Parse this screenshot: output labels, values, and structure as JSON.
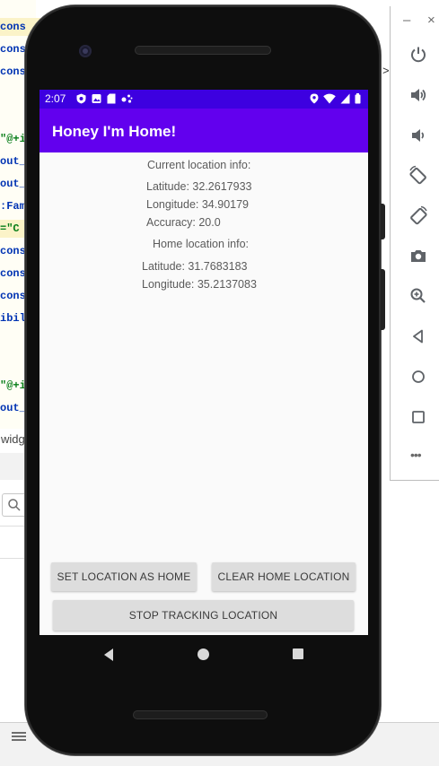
{
  "ide": {
    "code_lines": [
      {
        "text": "cons",
        "green": false,
        "hl": true
      },
      {
        "text": "cons",
        "green": false,
        "hl": false
      },
      {
        "text": "cons",
        "green": false,
        "hl": false
      },
      {
        "text": "\"@+i",
        "green": true,
        "hl": false
      },
      {
        "text": "out_",
        "green": false,
        "hl": false
      },
      {
        "text": "out_",
        "green": false,
        "hl": false
      },
      {
        "text": ":Fam",
        "green": false,
        "hl": false
      },
      {
        "text": "=\"C",
        "green": true,
        "hl": true
      },
      {
        "text": "cons",
        "green": false,
        "hl": false
      },
      {
        "text": "cons",
        "green": false,
        "hl": false
      },
      {
        "text": "cons",
        "green": false,
        "hl": false
      },
      {
        "text": "ibil",
        "green": false,
        "hl": false
      },
      {
        "text": "\"@+i",
        "green": true,
        "hl": false
      },
      {
        "text": "out_",
        "green": false,
        "hl": false
      }
    ],
    "breadcrumb": "widg"
  },
  "emulator_toolbar": {
    "minimize": "–",
    "close": "×",
    "more": "•••",
    "buttons": [
      "power-icon",
      "volume-up-icon",
      "volume-down-icon",
      "rotate-left-icon",
      "rotate-right-icon",
      "screenshot-icon",
      "zoom-icon",
      "back-icon",
      "home-icon",
      "overview-icon"
    ]
  },
  "status_bar": {
    "time": "2:07"
  },
  "app": {
    "title": "Honey I'm Home!",
    "current_header": "Current location info:",
    "latitude": "Latitude: 32.2617933",
    "longitude": "Longitude: 34.90179",
    "accuracy": "Accuracy: 20.0",
    "home_header": "Home location info:",
    "home_latitude": "Latitude: 31.7683183",
    "home_longitude": "Longitude: 35.2137083",
    "set_home_button": "SET LOCATION AS HOME",
    "clear_home_button": "CLEAR HOME LOCATION",
    "stop_tracking_button": "STOP TRACKING LOCATION"
  },
  "colors": {
    "status_bar": "#3d00e0",
    "app_bar": "#6200ee",
    "screen_bg": "#fafafa",
    "button_bg": "#dddddd"
  }
}
